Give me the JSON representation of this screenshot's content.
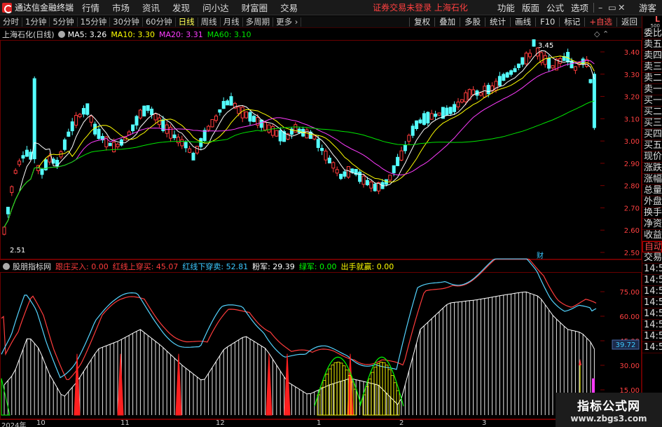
{
  "app": {
    "title": "通达信金融终端",
    "menu": [
      "行情",
      "市场",
      "资讯",
      "发现",
      "问小达",
      "财富圈",
      "交易"
    ],
    "notice": "证券交易未登录  上海石化",
    "right_menu": [
      "功能",
      "版面",
      "公式",
      "选项"
    ],
    "user": "游客"
  },
  "periods": [
    "分时",
    "1分钟",
    "5分钟",
    "15分钟",
    "30分钟",
    "60分钟",
    "日线",
    "周线",
    "月线",
    "多周期",
    "更多"
  ],
  "active_period": "日线",
  "tools": [
    "复权",
    "叠加",
    "多股",
    "统计",
    "画线",
    "F10",
    "标记",
    "+自选",
    "返回"
  ],
  "side_panel": {
    "corner_l": "L",
    "corner_n": "500",
    "items": [
      "委比",
      "卖五",
      "卖四",
      "卖三",
      "卖二",
      "卖一",
      "买一",
      "买二",
      "买三",
      "买四",
      "买五",
      "现价",
      "涨跌",
      "涨幅",
      "总量",
      "外盘",
      "换手",
      "净资",
      "收益"
    ],
    "items2": [
      "自动",
      "交易"
    ],
    "times": [
      "14:56",
      "14:56",
      "14:56",
      "14:56",
      "14:56",
      "14:56",
      "14:56",
      "14:56"
    ]
  },
  "main_chart": {
    "stock": "上海石化(日线)",
    "ma": [
      {
        "label": "MA5: 3.26",
        "color": "#ffffff"
      },
      {
        "label": "MA10: 3.30",
        "color": "#ffff00"
      },
      {
        "label": "MA20: 3.31",
        "color": "#ff3cff"
      },
      {
        "label": "MA60: 3.10",
        "color": "#00e600"
      }
    ],
    "y_ticks": [
      "3.40",
      "3.30",
      "3.20",
      "3.10",
      "3.00",
      "2.90",
      "2.80",
      "2.70",
      "2.60",
      "2.50"
    ],
    "high_label": "3.45",
    "low_label": "2.51",
    "cai_label": "财",
    "icons": "◇ ⌃"
  },
  "indicator": {
    "name": "股朋指标网",
    "items": [
      {
        "label": "跟庄买入: 0.00",
        "color": "#ff3c3c"
      },
      {
        "label": "红线上穿买: 45.07",
        "color": "#ff3c3c"
      },
      {
        "label": "红线下穿卖: 52.81",
        "color": "#3cc8ff"
      },
      {
        "label": "粉军: 29.39",
        "color": "#ffffff"
      },
      {
        "label": "绿军: 0.00",
        "color": "#00ff00"
      },
      {
        "label": "出手就赢: 0.00",
        "color": "#ffff00"
      }
    ],
    "y_ticks": [
      "75.00",
      "60.00",
      "45.00",
      "30.00",
      "15.00"
    ],
    "cursor_value": "39.72"
  },
  "dates": [
    "2024年",
    "10",
    "11",
    "12",
    "1",
    "2",
    "3"
  ],
  "watermark": {
    "line1": "指标公式网",
    "line2": "www.zbgs3.com"
  },
  "colors": {
    "up": "#ff3c3c",
    "down": "#54ffff",
    "ma5": "#ffffff",
    "ma10": "#ffff00",
    "ma20": "#ff3cff",
    "ma60": "#00e600"
  }
}
